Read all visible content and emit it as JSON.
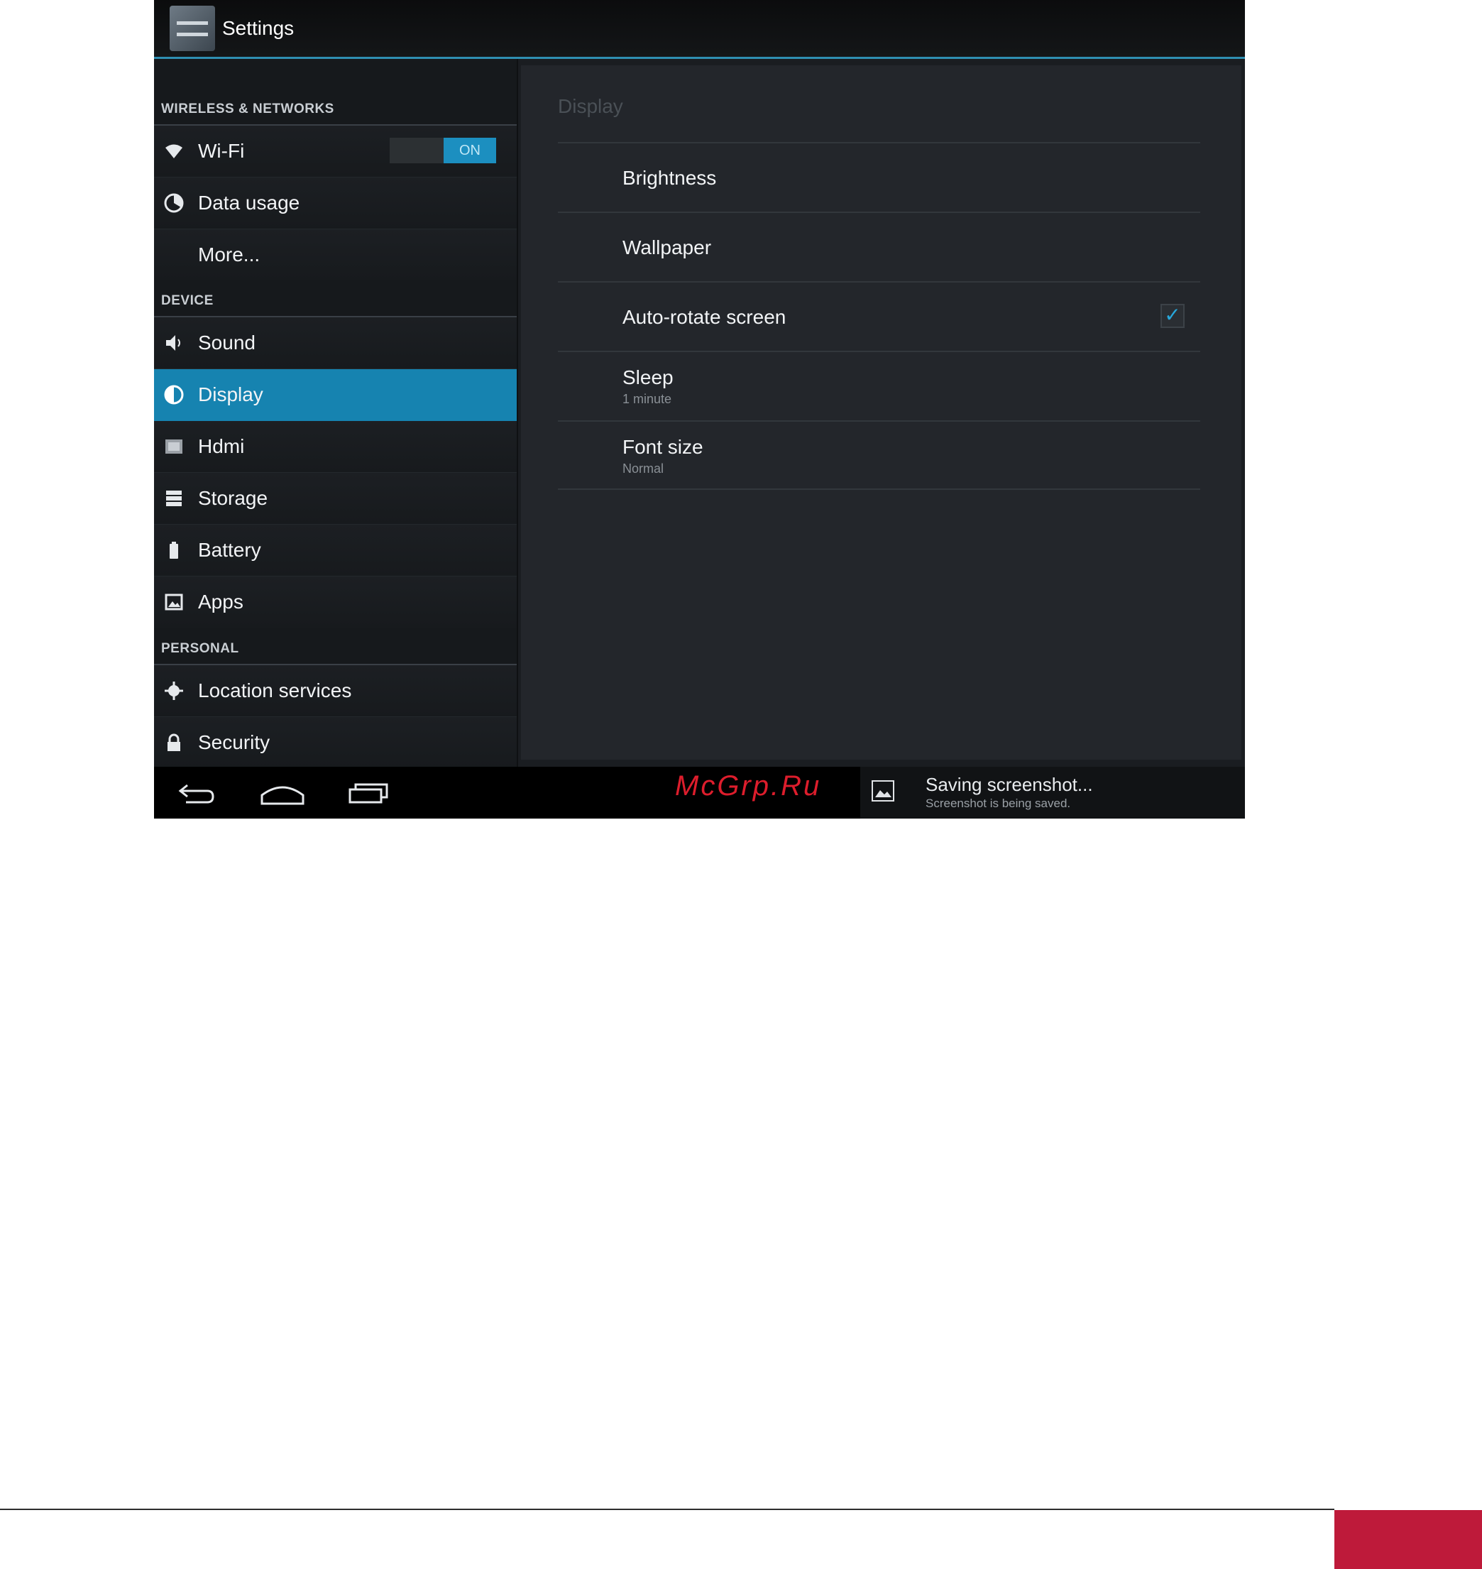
{
  "action_bar": {
    "title": "Settings",
    "app_icon": "settings-app-icon"
  },
  "sidebar": {
    "sections": [
      {
        "header": "WIRELESS & NETWORKS"
      },
      {
        "header": "DEVICE"
      },
      {
        "header": "PERSONAL"
      }
    ],
    "items": [
      {
        "label": "Wi-Fi",
        "icon": "wifi-icon"
      },
      {
        "label": "Data usage",
        "icon": "data-usage-icon"
      },
      {
        "label": "More..."
      },
      {
        "label": "Sound",
        "icon": "speaker-icon"
      },
      {
        "label": "Display",
        "icon": "display-icon",
        "active": true
      },
      {
        "label": "Hdmi",
        "icon": "hdmi-icon"
      },
      {
        "label": "Storage",
        "icon": "storage-icon"
      },
      {
        "label": "Battery",
        "icon": "battery-icon"
      },
      {
        "label": "Apps",
        "icon": "apps-icon"
      },
      {
        "label": "Location services",
        "icon": "location-icon"
      },
      {
        "label": "Security",
        "icon": "lock-icon"
      }
    ],
    "wifi_toggle": {
      "label": "ON",
      "state": "on"
    }
  },
  "display_pane": {
    "title": "Display",
    "prefs": [
      {
        "title": "Brightness"
      },
      {
        "title": "Wallpaper"
      },
      {
        "title": "Auto-rotate screen",
        "checked": true
      },
      {
        "title": "Sleep",
        "summary": "1 minute"
      },
      {
        "title": "Font size",
        "summary": "Normal"
      }
    ]
  },
  "nav_bar": {
    "buttons": [
      "back-icon",
      "home-icon",
      "recent-apps-icon"
    ]
  },
  "watermark": "McGrp.Ru",
  "notification": {
    "title": "Saving screenshot...",
    "text": "Screenshot is being saved.",
    "icon": "image-icon"
  },
  "colors": {
    "accent": "#1683b0",
    "footer": "#be1a3a",
    "watermark": "#dd1d2c"
  }
}
